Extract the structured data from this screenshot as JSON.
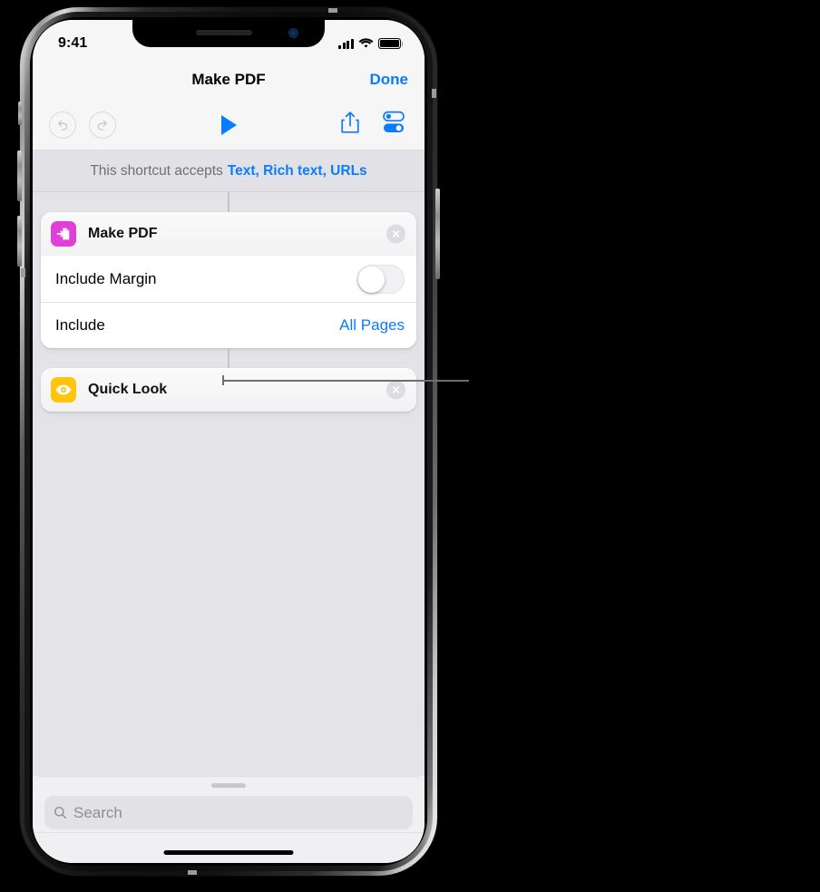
{
  "statusbar": {
    "time": "9:41",
    "cellular_icon": "cellular-bars-icon",
    "wifi_icon": "wifi-icon",
    "battery_icon": "battery-full-icon"
  },
  "navbar": {
    "title": "Make PDF",
    "done_label": "Done"
  },
  "toolbar": {
    "undo_icon": "undo-icon",
    "redo_icon": "redo-icon",
    "play_icon": "play-icon",
    "share_icon": "share-icon",
    "settings_icon": "shortcut-settings-icon"
  },
  "accepts_bar": {
    "prefix": "This shortcut accepts",
    "types": "Text, Rich text, URLs"
  },
  "workflow": {
    "actions": [
      {
        "title": "Make PDF",
        "icon": "make-pdf-icon",
        "icon_color": "#e040d8",
        "close_label": "×",
        "parameters": [
          {
            "label": "Include Margin",
            "type": "switch",
            "value": "off"
          },
          {
            "label": "Include",
            "type": "value",
            "value": "All Pages"
          }
        ]
      },
      {
        "title": "Quick Look",
        "icon": "quick-look-icon",
        "icon_color": "#ffc50d",
        "close_label": "×",
        "parameters": []
      }
    ]
  },
  "drawer": {
    "grabber": "drag-handle",
    "search": {
      "placeholder": "Search",
      "value": "",
      "icon": "search-icon"
    }
  },
  "callout": {
    "label": ""
  },
  "colors": {
    "accent_blue": "#0a7cff",
    "canvas_gray": "#e4e4e8",
    "chrome_gray": "#f6f6f6",
    "accepts_gray": "#e2e2e6"
  }
}
